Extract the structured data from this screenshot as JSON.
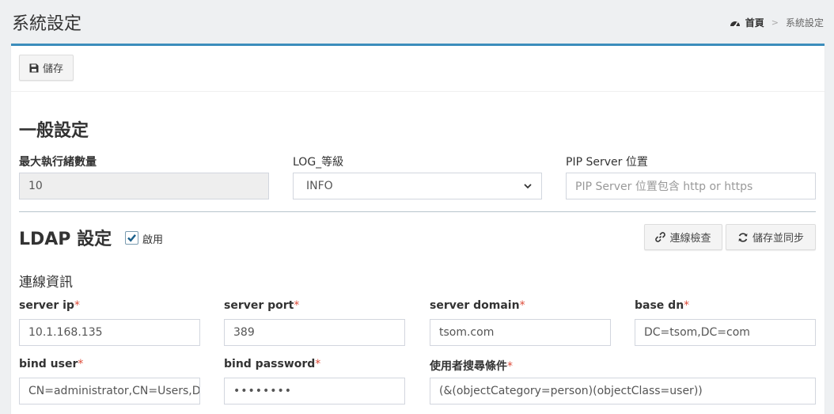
{
  "header": {
    "title": "系統設定",
    "breadcrumb": {
      "home": "首頁",
      "separator": ">",
      "current": "系統設定"
    }
  },
  "toolbar": {
    "save_label": "儲存"
  },
  "general": {
    "title": "一般設定",
    "max_threads": {
      "label": "最大執行緒數量",
      "value": "10"
    },
    "log_level": {
      "label": "LOG_等級",
      "value": "INFO"
    },
    "pip_server": {
      "label": "PIP Server 位置",
      "placeholder": "PIP Server 位置包含 http or https"
    }
  },
  "ldap": {
    "title": "LDAP 設定",
    "enabled_label": "啟用",
    "enabled": true,
    "check_button": "連線檢查",
    "sync_button": "儲存並同步",
    "connection_title": "連線資訊",
    "fields": {
      "server_ip": {
        "label": "server ip",
        "value": "10.1.168.135"
      },
      "server_port": {
        "label": "server port",
        "value": "389"
      },
      "server_domain": {
        "label": "server domain",
        "value": "tsom.com"
      },
      "base_dn": {
        "label": "base dn",
        "value": "DC=tsom,DC=com"
      },
      "bind_user": {
        "label": "bind user",
        "value": "CN=administrator,CN=Users,D"
      },
      "bind_password": {
        "label": "bind password",
        "value": "••••••••"
      },
      "user_filter": {
        "label": "使用者搜尋條件",
        "value": "(&(objectCategory=person)(objectClass=user))"
      }
    },
    "required_mark": "*"
  },
  "colors": {
    "accent": "#3c8dbc",
    "required": "#dd4b39",
    "checkbox": "#1a5f8a"
  }
}
